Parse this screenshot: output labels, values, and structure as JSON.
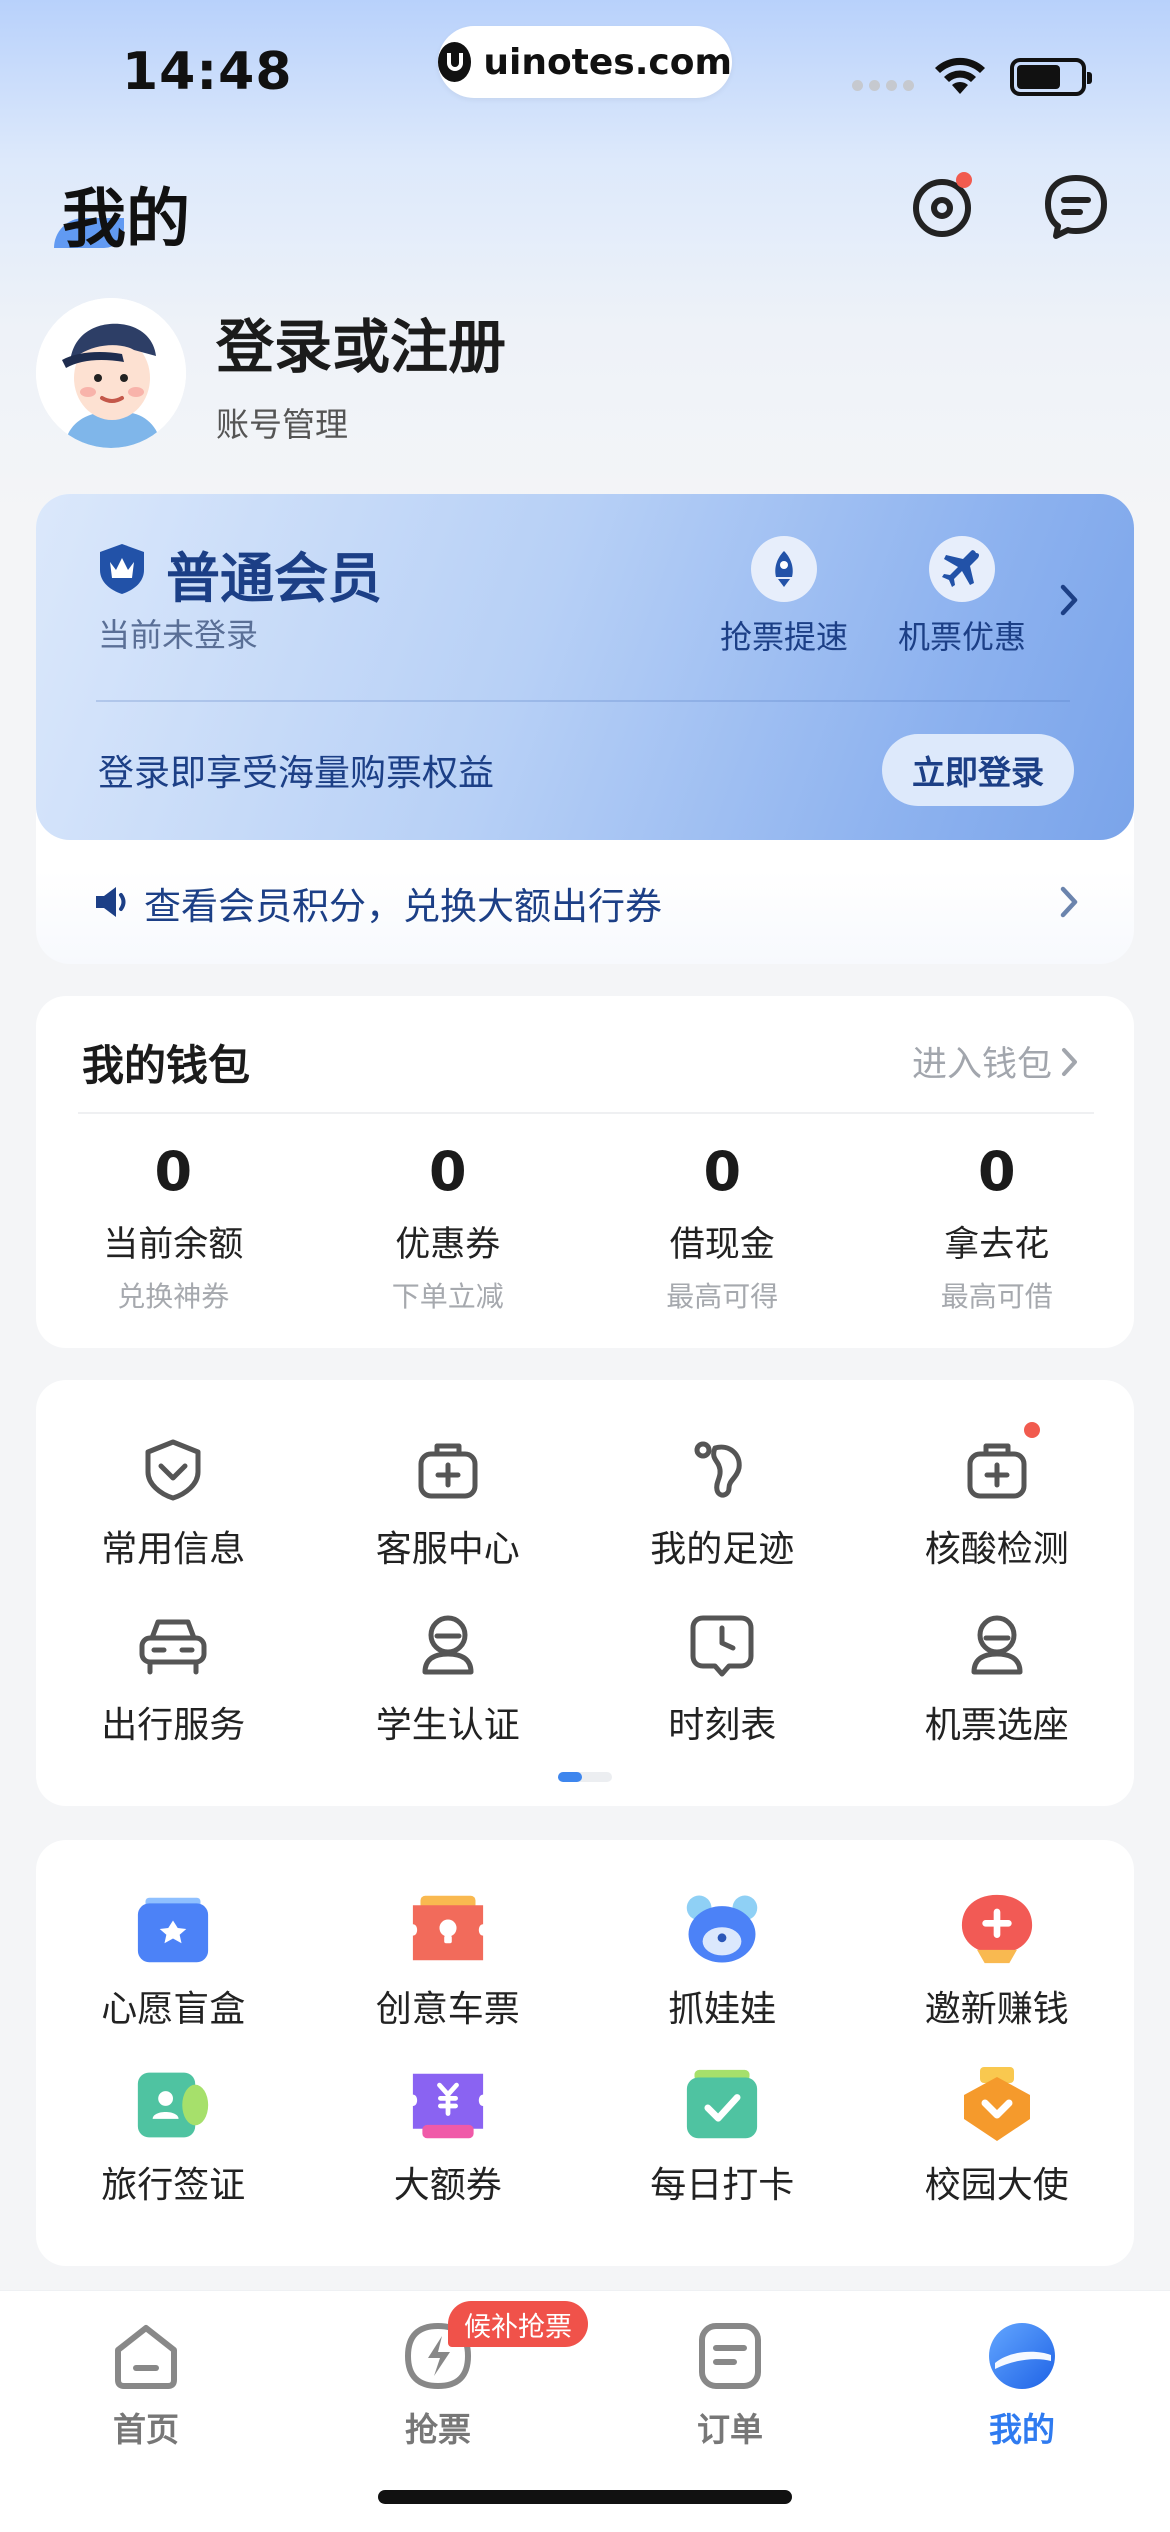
{
  "status_bar": {
    "time": "14:48",
    "url": "uinotes.com"
  },
  "header": {
    "title": "我的",
    "icons": [
      "settings-icon",
      "message-icon"
    ]
  },
  "profile": {
    "login_title": "登录或注册",
    "account_management": "账号管理"
  },
  "member_card": {
    "level": "普通会员",
    "status": "当前未登录",
    "perks": [
      {
        "label": "抢票提速",
        "icon": "rocket-icon"
      },
      {
        "label": "机票优惠",
        "icon": "plane-icon"
      }
    ],
    "promo_text": "登录即享受海量购票权益",
    "login_button": "立即登录",
    "points_text": "查看会员积分，兑换大额出行券"
  },
  "wallet": {
    "title": "我的钱包",
    "enter_link": "进入钱包",
    "items": [
      {
        "value": "0",
        "label": "当前余额",
        "sub": "兑换神券"
      },
      {
        "value": "0",
        "label": "优惠券",
        "sub": "下单立减"
      },
      {
        "value": "0",
        "label": "借现金",
        "sub": "最高可得"
      },
      {
        "value": "0",
        "label": "拿去花",
        "sub": "最高可借"
      }
    ]
  },
  "services": [
    {
      "label": "常用信息",
      "icon": "badge-icon"
    },
    {
      "label": "客服中心",
      "icon": "service-bag-icon"
    },
    {
      "label": "我的足迹",
      "icon": "footprint-icon"
    },
    {
      "label": "核酸检测",
      "icon": "medical-kit-icon"
    },
    {
      "label": "出行服务",
      "icon": "car-icon"
    },
    {
      "label": "学生认证",
      "icon": "student-icon"
    },
    {
      "label": "时刻表",
      "icon": "clock-icon"
    },
    {
      "label": "机票选座",
      "icon": "seat-icon"
    }
  ],
  "promos": [
    {
      "label": "心愿盲盒",
      "icon": "blind-box-icon",
      "color": "#4c82f7"
    },
    {
      "label": "创意车票",
      "icon": "ticket-icon",
      "color": "#f26b5b"
    },
    {
      "label": "抓娃娃",
      "icon": "bear-icon",
      "color": "#4c82f7"
    },
    {
      "label": "邀新赚钱",
      "icon": "invite-icon",
      "color": "#f25a55"
    },
    {
      "label": "旅行签证",
      "icon": "visa-icon",
      "color": "#4fc3a1"
    },
    {
      "label": "大额券",
      "icon": "coupon-icon",
      "color": "#8a63f2"
    },
    {
      "label": "每日打卡",
      "icon": "checkin-icon",
      "color": "#4fc3a1"
    },
    {
      "label": "校园大使",
      "icon": "ambassador-icon",
      "color": "#f59a2c"
    }
  ],
  "tabbar": {
    "tabs": [
      {
        "label": "首页",
        "icon": "home-icon"
      },
      {
        "label": "抢票",
        "icon": "grab-ticket-icon"
      },
      {
        "label": "订单",
        "icon": "order-icon"
      },
      {
        "label": "我的",
        "icon": "mine-icon"
      }
    ],
    "badge": "候补抢票",
    "active_index": 3
  },
  "colors": {
    "accent": "#2f7bf0",
    "member_text": "#1c3f86",
    "badge_red": "#f0524a"
  }
}
